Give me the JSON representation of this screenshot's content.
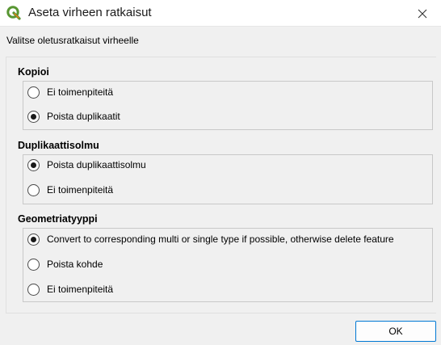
{
  "window": {
    "title": "Aseta virheen ratkaisut",
    "app_icon": "qgis-logo-icon",
    "close_icon": "close-icon"
  },
  "subtitle": "Valitse oletusratkaisut virheelle",
  "sections": [
    {
      "title": "Kopioi",
      "options": [
        {
          "label": "Ei toimenpiteitä",
          "checked": false
        },
        {
          "label": "Poista duplikaatit",
          "checked": true
        }
      ]
    },
    {
      "title": "Duplikaattisolmu",
      "options": [
        {
          "label": "Poista duplikaattisolmu",
          "checked": true
        },
        {
          "label": "Ei toimenpiteitä",
          "checked": false
        }
      ]
    },
    {
      "title": "Geometriatyyppi",
      "options": [
        {
          "label": "Convert to corresponding multi or single type if possible, otherwise delete feature",
          "checked": true
        },
        {
          "label": "Poista kohde",
          "checked": false
        },
        {
          "label": "Ei toimenpiteitä",
          "checked": false
        }
      ]
    }
  ],
  "buttons": {
    "ok_label": "OK"
  },
  "colors": {
    "accent": "#0078d4",
    "qgis_green": "#589632",
    "qgis_yellow": "#ee7913"
  }
}
